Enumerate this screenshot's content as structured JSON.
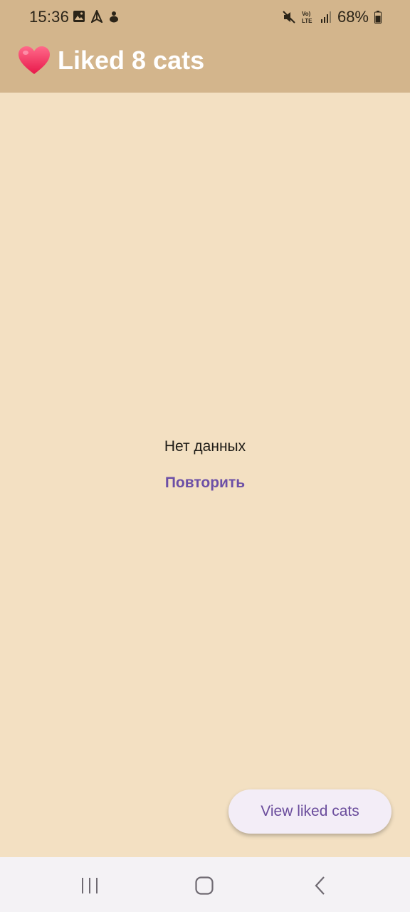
{
  "status_bar": {
    "time": "15:36",
    "battery": "68%",
    "icons": [
      "gallery-icon",
      "navigation-icon",
      "app-icon",
      "mute-icon",
      "volte-icon",
      "signal-icon",
      "battery-icon"
    ]
  },
  "app_bar": {
    "title": "Liked 8 cats",
    "icon": "heart-icon",
    "background": "#d3b58c"
  },
  "main": {
    "empty_text": "Нет данных",
    "retry_label": "Повторить",
    "background": "#f3e0c2",
    "accent": "#6c4fa6"
  },
  "fab": {
    "label": "View liked cats"
  },
  "nav_bar": {
    "items": [
      "recents-icon",
      "home-icon",
      "back-icon"
    ]
  }
}
